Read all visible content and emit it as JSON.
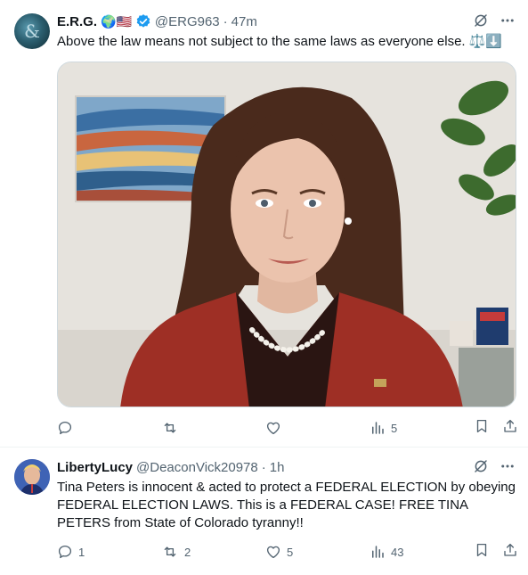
{
  "posts": [
    {
      "name": "E.R.G.",
      "flags": "🌍🇺🇸",
      "handle": "@ERG963",
      "separator": "·",
      "time": "47m",
      "text": "Above the law means not subject to the same laws as everyone else. ⚖️⬇️",
      "actions": {
        "replies": "",
        "reposts": "",
        "likes": "",
        "views": "5"
      }
    },
    {
      "name": "LibertyLucy",
      "handle": "@DeaconVick20978",
      "separator": "·",
      "time": "1h",
      "text": "Tina Peters is innocent & acted to protect a FEDERAL ELECTION by obeying FEDERAL ELECTION LAWS. This is a FEDERAL CASE!  FREE TINA PETERS from State of Colorado tyranny!!",
      "actions": {
        "replies": "1",
        "reposts": "2",
        "likes": "5",
        "views": "43"
      }
    }
  ],
  "colors": {
    "text": "#0f1419",
    "secondary": "#536471",
    "verified": "#1d9bf0",
    "border": "#eff3f4"
  },
  "icons": [
    "grok-icon",
    "more-icon",
    "verified-icon",
    "reply-icon",
    "repost-icon",
    "like-icon",
    "views-icon",
    "bookmark-icon",
    "share-icon"
  ]
}
